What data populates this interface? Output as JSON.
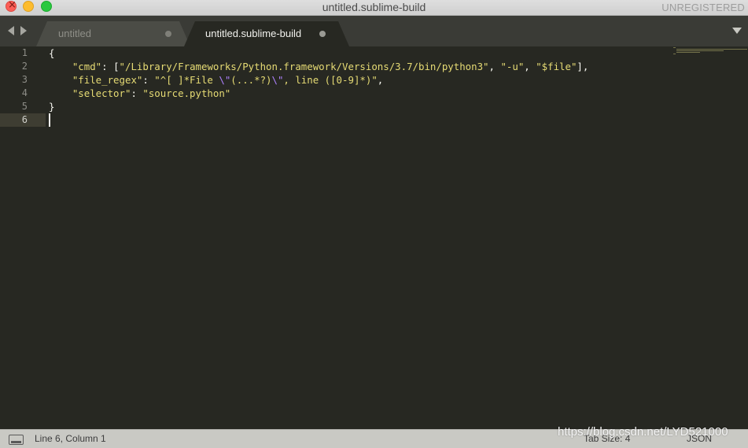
{
  "window": {
    "title": "untitled.sublime-build",
    "license_status": "UNREGISTERED"
  },
  "tabs": [
    {
      "label": "untitled",
      "active": false,
      "dirty": true
    },
    {
      "label": "untitled.sublime-build",
      "active": true,
      "dirty": true
    }
  ],
  "editor": {
    "line_numbers": [
      "1",
      "2",
      "3",
      "4",
      "5",
      "6"
    ],
    "current_line": 6,
    "code": {
      "line1_brace": "{",
      "line2_indent": "    ",
      "line2_key": "\"cmd\"",
      "line2_sep": ": [",
      "line2_str1": "\"/Library/Frameworks/Python.framework/Versions/3.7/bin/python3\"",
      "line2_comma1": ", ",
      "line2_str2": "\"-u\"",
      "line2_comma2": ", ",
      "line2_str3": "\"$file\"",
      "line2_end": "],",
      "line3_indent": "    ",
      "line3_key": "\"file_regex\"",
      "line3_sep": ": ",
      "line3_str_a": "\"^[ ]*File ",
      "line3_esc1": "\\\"",
      "line3_str_b": "(...*?)",
      "line3_esc2": "\\\"",
      "line3_str_c": ", line ([0-9]*)\"",
      "line3_end": ",",
      "line4_indent": "    ",
      "line4_key": "\"selector\"",
      "line4_sep": ": ",
      "line4_str": "\"source.python\"",
      "line5_brace": "}"
    }
  },
  "statusbar": {
    "position": "Line 6, Column 1",
    "tab_size": "Tab Size: 4",
    "syntax": "JSON"
  },
  "watermark": "https://blog.csdn.net/LYD521000",
  "colors": {
    "background": "#272822",
    "string": "#e6db74",
    "escape": "#ae81ff",
    "text": "#f8f8f2"
  }
}
